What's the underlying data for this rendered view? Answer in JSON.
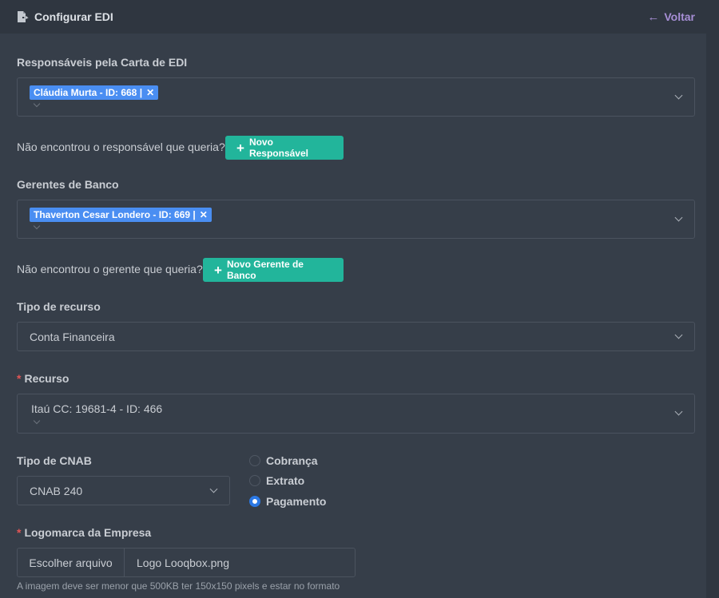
{
  "header": {
    "title": "Configurar EDI",
    "back_label": "Voltar",
    "title_icon": "file-export-icon",
    "back_icon": "arrow-left-icon"
  },
  "responsaveis": {
    "label": "Responsáveis pela Carta de EDI",
    "tag": "Cláudia Murta - ID: 668 |",
    "note": "Não encontrou o responsável que queria?",
    "button": "Novo Responsável"
  },
  "gerentes": {
    "label": "Gerentes de Banco",
    "tag": "Thaverton Cesar Londero - ID: 669 |",
    "note": "Não encontrou o gerente que queria?",
    "button": "Novo Gerente de Banco"
  },
  "tipo_recurso": {
    "label": "Tipo de recurso",
    "value": "Conta Financeira"
  },
  "recurso": {
    "label": "Recurso",
    "value": "Itaú CC: 19681-4 - ID: 466"
  },
  "tipo_cnab": {
    "label": "Tipo de CNAB",
    "value": "CNAB 240",
    "options": [
      "Cobrança",
      "Extrato",
      "Pagamento"
    ],
    "selected": "Pagamento"
  },
  "logomarca": {
    "label": "Logomarca da Empresa",
    "button": "Escolher arquivo",
    "filename": "Logo Looqbox.png",
    "help": "A imagem deve ser menor que 500KB ter 150x150 pixels e estar no formato"
  },
  "colors": {
    "accent": "#22b59b",
    "tag": "#4a8ef2",
    "link": "#a78fd6",
    "background": "#363e49"
  }
}
